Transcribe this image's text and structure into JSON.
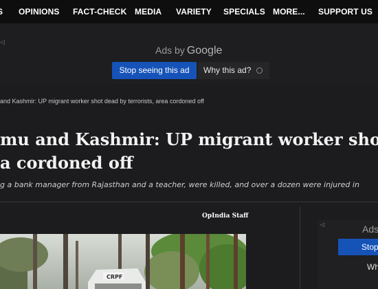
{
  "nav": {
    "left_fragment": "S",
    "items": [
      "OPINIONS",
      "FACT-CHECK",
      "MEDIA",
      "VARIETY",
      "SPECIALS",
      "MORE...",
      "SUPPORT US"
    ]
  },
  "ad_top": {
    "ads_by": "Ads by",
    "brand": "Google",
    "stop_label": "Stop seeing this ad",
    "why_label": "Why this ad?"
  },
  "breadcrumb": "and Kashmir: UP migrant worker shot dead by terrorists, area cordoned off",
  "article": {
    "headline_line1": "mu and Kashmir: UP migrant worker shot d",
    "headline_line2": "a cordoned off",
    "subheadline": "g a bank manager from Rajasthan and a teacher, were killed, and over a dozen were injured in",
    "author": "OpIndia Staff",
    "photo_text": "CRPF"
  },
  "ad_side": {
    "ads_label": "Ads",
    "stop_label": "Stop",
    "why_label": "Wh"
  },
  "colors": {
    "nav_bg": "#0e0e0f",
    "page_bg": "#1c1c1e",
    "ad_button": "#1553b8"
  }
}
